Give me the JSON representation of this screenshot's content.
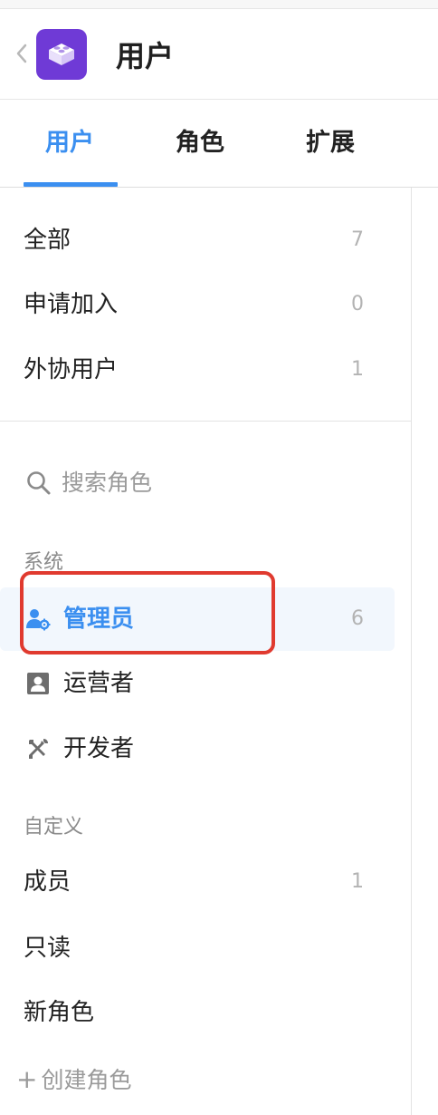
{
  "header": {
    "title": "用户"
  },
  "tabs": [
    {
      "label": "用户",
      "active": true
    },
    {
      "label": "角色",
      "active": false
    },
    {
      "label": "扩展",
      "active": false
    }
  ],
  "user_filters": [
    {
      "label": "全部",
      "count": "7"
    },
    {
      "label": "申请加入",
      "count": "0"
    },
    {
      "label": "外协用户",
      "count": "1"
    }
  ],
  "search": {
    "placeholder": "搜索角色"
  },
  "system_group": {
    "title": "系统",
    "items": [
      {
        "label": "管理员",
        "count": "6",
        "icon": "admin-gear-icon",
        "selected": true
      },
      {
        "label": "运营者",
        "count": "",
        "icon": "id-card-icon"
      },
      {
        "label": "开发者",
        "count": "",
        "icon": "tools-icon"
      }
    ]
  },
  "custom_group": {
    "title": "自定义",
    "items": [
      {
        "label": "成员",
        "count": "1"
      },
      {
        "label": "只读",
        "count": ""
      },
      {
        "label": "新角色",
        "count": ""
      }
    ]
  },
  "create_role": {
    "label": "创建角色",
    "icon": "plus-icon"
  },
  "colors": {
    "accent": "#3b8ff0",
    "logo": "#6f3ad6",
    "highlight": "#e03a2f"
  }
}
